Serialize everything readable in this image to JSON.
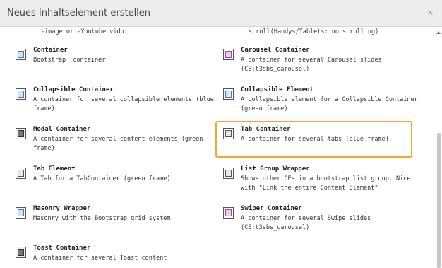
{
  "header": {
    "title": "Neues Inhaltselement erstellen",
    "close": "×"
  },
  "cutoff": {
    "left": "-image or -Youtube vido.",
    "right": "scroll(Handys/Tablets: no scrolling)"
  },
  "items": [
    {
      "name": "Container",
      "desc": "Bootstrap .container",
      "icon": "container-icon"
    },
    {
      "name": "Carousel Container",
      "desc": "A container for several Carousel slides (CE:t3sbs_carousel)",
      "icon": "carousel-icon"
    },
    {
      "name": "Collapsible Container",
      "desc": "A container for several collapsible elements (blue frame)",
      "icon": "collapsible-container-icon"
    },
    {
      "name": "Collapsible Element",
      "desc": "A collapsible element for a Collapsible Container (green frame)",
      "icon": "collapsible-element-icon"
    },
    {
      "name": "Modal Container",
      "desc": "A container for several content elements (green frame)",
      "icon": "modal-icon"
    },
    {
      "name": "Tab Container",
      "desc": "A container for several tabs (blue frame)",
      "icon": "tab-container-icon"
    },
    {
      "name": "Tab Element",
      "desc": "A Tab for a TabContainer (green frame)",
      "icon": "tab-element-icon"
    },
    {
      "name": "List Group Wrapper",
      "desc": "Shows other CEs in a bootstrap list group. Nice with \"Link the entire Content Element\"",
      "icon": "list-group-icon"
    },
    {
      "name": "Masonry Wrapper",
      "desc": "Masonry with the Bootstrap grid system",
      "icon": "masonry-icon"
    },
    {
      "name": "Swiper Container",
      "desc": "A container for several Swipe slides (CE:t3sbs_carousel)",
      "icon": "swiper-icon"
    },
    {
      "name": "Toast Container",
      "desc": "A container for several Toast content",
      "icon": "toast-icon"
    }
  ],
  "colors": {
    "highlight": "#f0a830",
    "header_bg": "#ededed"
  }
}
